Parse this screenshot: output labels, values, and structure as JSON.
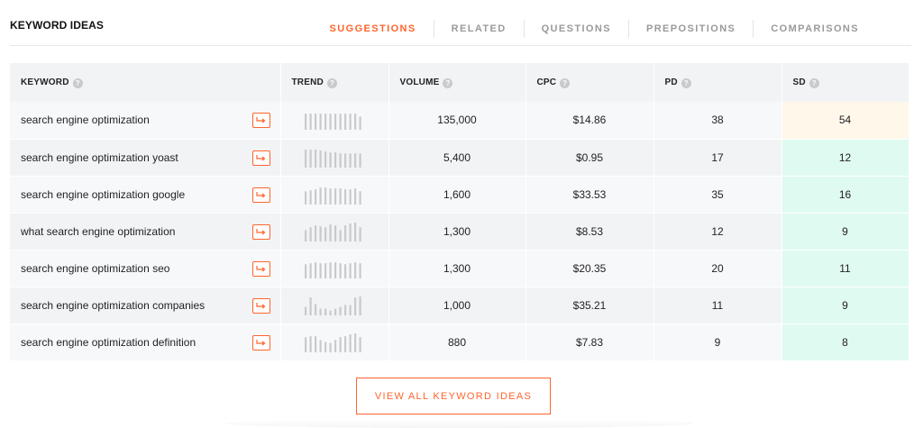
{
  "title": "KEYWORD IDEAS",
  "tabs": [
    "SUGGESTIONS",
    "RELATED",
    "QUESTIONS",
    "PREPOSITIONS",
    "COMPARISONS"
  ],
  "active_tab": "SUGGESTIONS",
  "columns": {
    "keyword": "KEYWORD",
    "trend": "TREND",
    "volume": "VOLUME",
    "cpc": "CPC",
    "pd": "PD",
    "sd": "SD",
    "help_icon": "?"
  },
  "colors": {
    "accent": "#ff642d",
    "sd_low_bg": "#dffaf0",
    "sd_mid_bg": "#fff8ea",
    "trend_bar": "#c8cacd"
  },
  "rows": [
    {
      "keyword": "search engine optimization",
      "volume": "135,000",
      "cpc": "$14.86",
      "pd": "38",
      "sd": "54",
      "sd_level": "mid",
      "trend": [
        0.85,
        0.85,
        0.85,
        0.85,
        0.85,
        0.85,
        0.85,
        0.85,
        0.85,
        0.85,
        0.85,
        0.7
      ]
    },
    {
      "keyword": "search engine optimization yoast",
      "volume": "5,400",
      "cpc": "$0.95",
      "pd": "17",
      "sd": "12",
      "sd_level": "low",
      "trend": [
        0.95,
        0.95,
        0.95,
        0.9,
        0.85,
        0.8,
        0.8,
        0.75,
        0.75,
        0.75,
        0.75,
        0.75
      ]
    },
    {
      "keyword": "search engine optimization google",
      "volume": "1,600",
      "cpc": "$33.53",
      "pd": "35",
      "sd": "16",
      "sd_level": "low",
      "trend": [
        0.7,
        0.75,
        0.8,
        0.9,
        0.9,
        0.85,
        0.85,
        0.85,
        0.8,
        0.8,
        0.85,
        0.7
      ]
    },
    {
      "keyword": "what search engine optimization",
      "volume": "1,300",
      "cpc": "$8.53",
      "pd": "12",
      "sd": "9",
      "sd_level": "low",
      "trend": [
        0.6,
        0.75,
        0.85,
        0.8,
        0.75,
        0.9,
        0.85,
        0.6,
        0.85,
        0.95,
        1.0,
        0.75
      ]
    },
    {
      "keyword": "search engine optimization seo",
      "volume": "1,300",
      "cpc": "$20.35",
      "pd": "20",
      "sd": "11",
      "sd_level": "low",
      "trend": [
        0.75,
        0.8,
        0.85,
        0.8,
        0.8,
        0.85,
        0.85,
        0.8,
        0.75,
        0.8,
        0.85,
        0.8
      ]
    },
    {
      "keyword": "search engine optimization companies",
      "volume": "1,000",
      "cpc": "$35.21",
      "pd": "11",
      "sd": "9",
      "sd_level": "low",
      "trend": [
        0.45,
        0.95,
        0.6,
        0.35,
        0.35,
        0.25,
        0.35,
        0.45,
        0.55,
        0.55,
        0.95,
        1.0
      ]
    },
    {
      "keyword": "search engine optimization definition",
      "volume": "880",
      "cpc": "$7.83",
      "pd": "9",
      "sd": "8",
      "sd_level": "low",
      "trend": [
        0.8,
        0.85,
        0.85,
        0.65,
        0.55,
        0.5,
        0.65,
        0.8,
        0.85,
        0.95,
        1.0,
        0.8
      ]
    }
  ],
  "view_all_label": "VIEW ALL KEYWORD IDEAS"
}
